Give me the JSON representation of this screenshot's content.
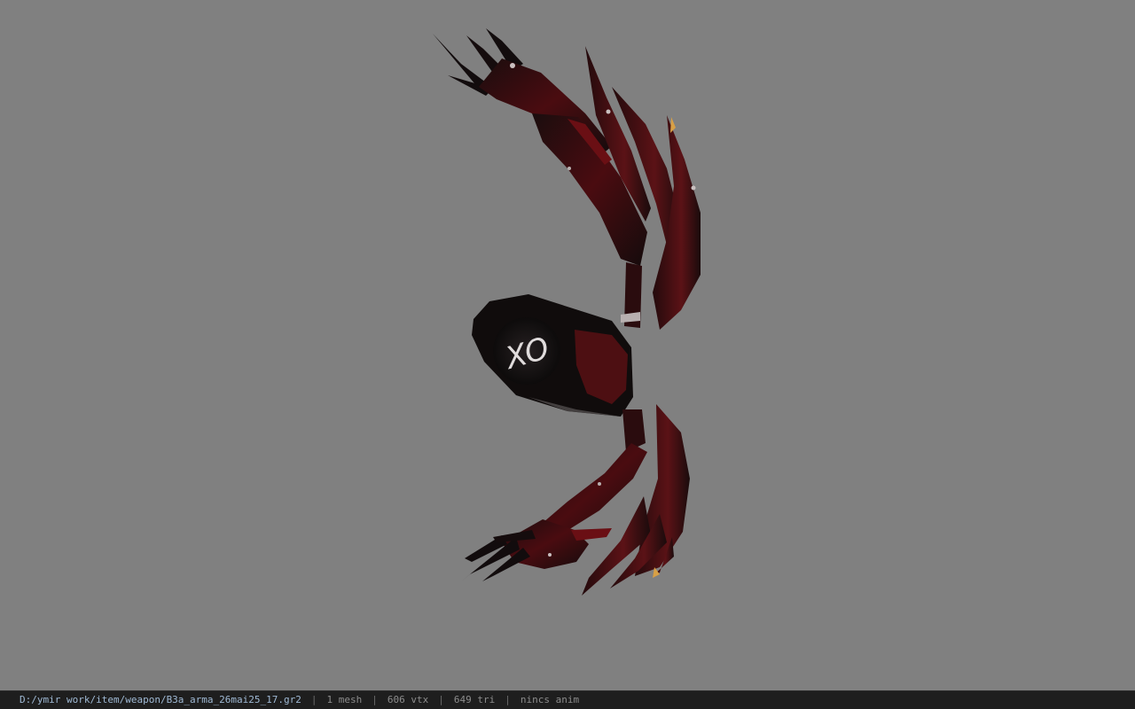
{
  "viewer": {
    "background_color": "#808080",
    "model_colors": {
      "dark": "#120c0d",
      "blood": "#5a0f12",
      "deep_red": "#3a0a0c",
      "highlight": "#c9c0c0",
      "tip": "#d8a046"
    },
    "model_icon": "weapon-claw-model",
    "emblem_text": "XO"
  },
  "statusbar": {
    "file_path": "D:/ymir work/item/weapon/B3a_arma_26mai25_17.gr2",
    "separator": "|",
    "mesh_count": "1 mesh",
    "vertex_count": "606 vtx",
    "triangle_count": "649 tri",
    "animation": "nincs anim"
  }
}
